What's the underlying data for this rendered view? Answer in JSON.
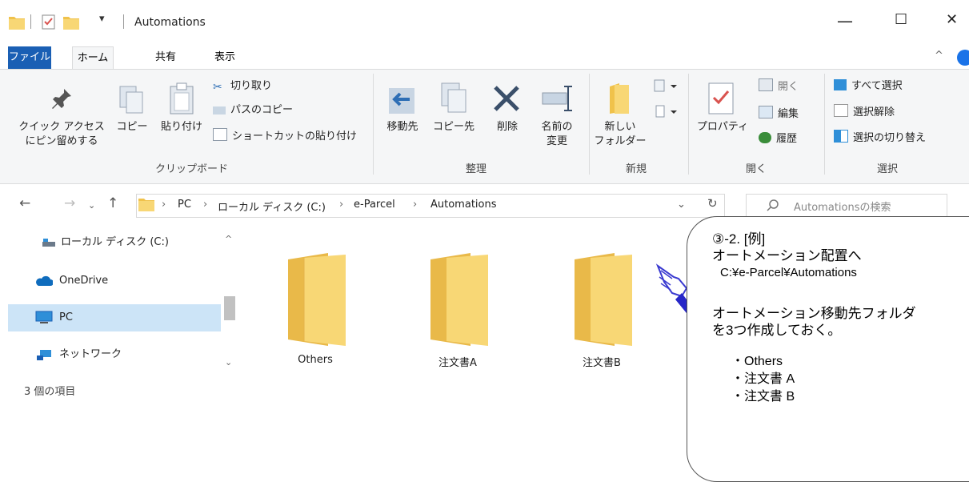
{
  "window": {
    "title": "Automations",
    "minimize_glyph": "—",
    "maximize_glyph": "☐",
    "close_glyph": "✕"
  },
  "tabs": {
    "file": "ファイル",
    "home": "ホーム",
    "share": "共有",
    "view": "表示"
  },
  "ribbon": {
    "pin": "クイック アクセス\nにピン留めする",
    "copy": "コピー",
    "paste": "貼り付け",
    "cut": "切り取り",
    "copy_path": "パスのコピー",
    "paste_shortcut": "ショートカットの貼り付け",
    "clipboard_group": "クリップボード",
    "move_to": "移動先",
    "copy_to": "コピー先",
    "delete": "削除",
    "rename": "名前の\n変更",
    "organize_group": "整理",
    "new_folder": "新しい\nフォルダー",
    "new_group": "新規",
    "properties": "プロパティ",
    "open": "開く",
    "edit": "編集",
    "history": "履歴",
    "open_group": "開く",
    "select_all": "すべて選択",
    "select_none": "選択解除",
    "invert_selection": "選択の切り替え",
    "select_group": "選択"
  },
  "address": {
    "crumbs": [
      "PC",
      "ローカル ディスク (C:)",
      "e-Parcel",
      "Automations"
    ],
    "search_placeholder": "Automationsの検索"
  },
  "sidebar": {
    "items": [
      "ローカル ディスク (C:)",
      "OneDrive",
      "PC",
      "ネットワーク"
    ]
  },
  "status": {
    "item_count": "3 個の項目"
  },
  "folders": [
    "Others",
    "注文書A",
    "注文書B"
  ],
  "callout": {
    "line1": "③-2. [例]",
    "line2": "オートメーション配置へ",
    "line3": "C:¥e-Parcel¥Automations",
    "line4": "オートメーション移動先フォルダ",
    "line5": "を3つ作成しておく。",
    "line6": "・Others",
    "line7": "・注文書 A",
    "line8": "・注文書 B"
  },
  "colors": {
    "accent": "#1a5fb4",
    "folder": "#f8d775",
    "folder_dark": "#e9b949",
    "selection": "#cce4f7"
  }
}
